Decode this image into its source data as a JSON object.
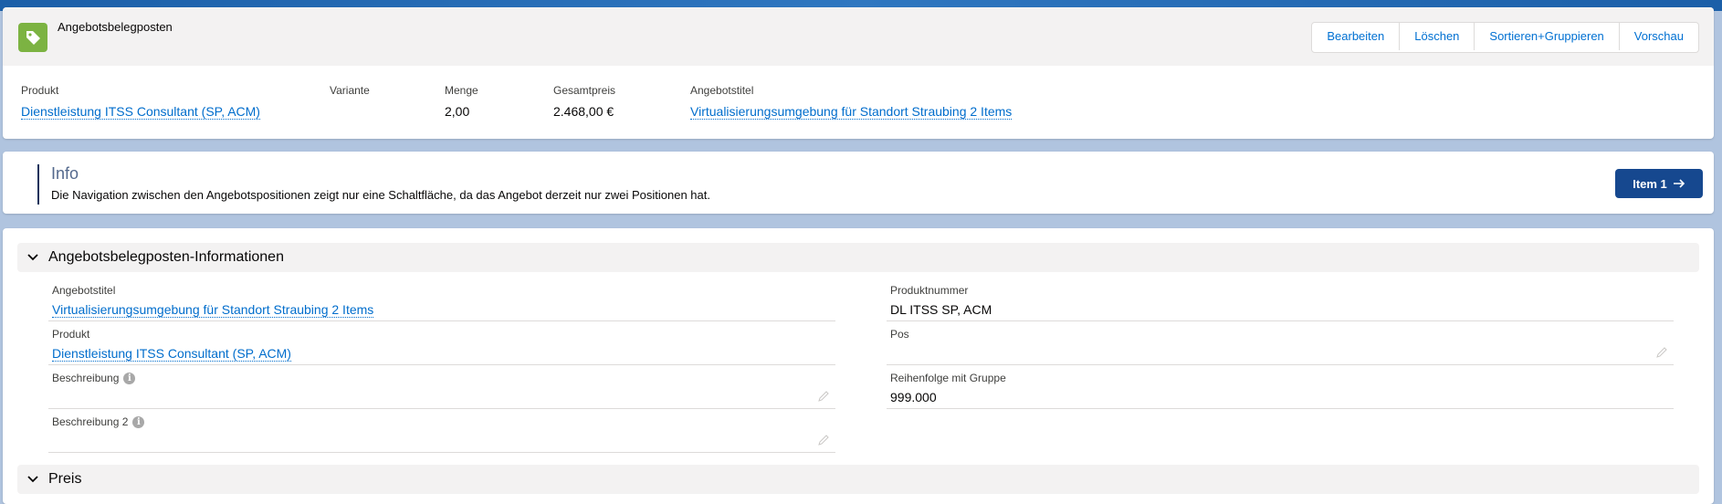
{
  "header": {
    "object_title": "Angebotsbelegposten",
    "actions": [
      "Bearbeiten",
      "Löschen",
      "Sortieren+Gruppieren",
      "Vorschau"
    ]
  },
  "highlights": [
    {
      "label": "Produkt",
      "value": "Dienstleistung ITSS Consultant (SP, ACM)",
      "is_link": true
    },
    {
      "label": "Variante",
      "value": "",
      "is_link": false
    },
    {
      "label": "Menge",
      "value": "2,00",
      "is_link": false
    },
    {
      "label": "Gesamtpreis",
      "value": "2.468,00 €",
      "is_link": false
    },
    {
      "label": "Angebotstitel",
      "value": "Virtualisierungsumgebung für Standort Straubing 2 Items",
      "is_link": true
    }
  ],
  "info": {
    "title": "Info",
    "text": "Die Navigation zwischen den Angebotspositionen zeigt nur eine Schaltfläche, da das Angebot derzeit nur zwei Positionen hat.",
    "button_label": "Item 1"
  },
  "details": {
    "section1_title": "Angebotsbelegposten-Informationen",
    "left": [
      {
        "label": "Angebotstitel",
        "value": "Virtualisierungsumgebung für Standort Straubing 2 Items",
        "is_link": true
      },
      {
        "label": "Produkt",
        "value": "Dienstleistung ITSS Consultant (SP, ACM)",
        "is_link": true
      },
      {
        "label": "Beschreibung",
        "value": "",
        "is_link": false
      },
      {
        "label": "Beschreibung 2",
        "value": "",
        "is_link": false
      }
    ],
    "right": [
      {
        "label": "Produktnummer",
        "value": "DL ITSS SP, ACM"
      },
      {
        "label": "Pos",
        "value": ""
      },
      {
        "label": "Reihenfolge mit Gruppe",
        "value": "999.000"
      }
    ],
    "section2_title": "Preis"
  },
  "colors": {
    "link": "#006dcc",
    "brand_button": "#16488f",
    "object_icon": "#7cb342"
  }
}
